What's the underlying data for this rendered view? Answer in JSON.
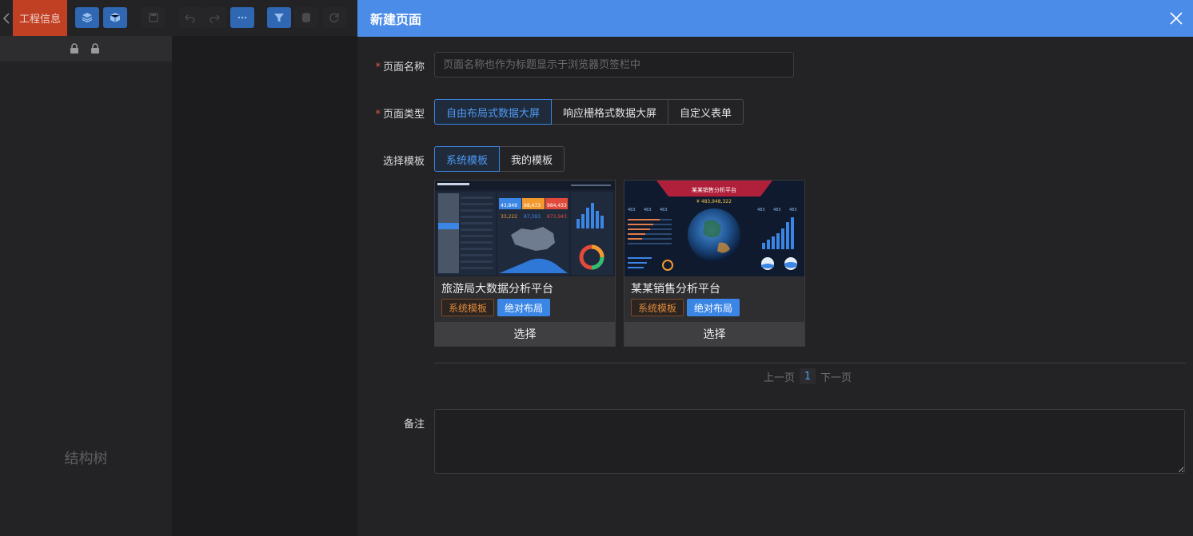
{
  "app": {
    "project_tab": "工程信息",
    "structure_label": "结构树"
  },
  "drawer": {
    "title": "新建页面",
    "name_field": {
      "label": "页面名称",
      "value": "",
      "placeholder": "页面名称也作为标题显示于浏览器页签栏中"
    },
    "type_field": {
      "label": "页面类型",
      "options": [
        "自由布局式数据大屏",
        "响应栅格式数据大屏",
        "自定义表单"
      ],
      "selected": "自由布局式数据大屏"
    },
    "template_field": {
      "label": "选择模板",
      "options": [
        "系统模板",
        "我的模板"
      ],
      "selected": "系统模板"
    },
    "templates": [
      {
        "title": "旅游局大数据分析平台",
        "tags": [
          "系统模板",
          "绝对布局"
        ],
        "select_label": "选择"
      },
      {
        "title": "某某销售分析平台",
        "tags": [
          "系统模板",
          "绝对布局"
        ],
        "select_label": "选择"
      }
    ],
    "thumbs": {
      "tour": {
        "k1": "43,849",
        "k2": "98,473",
        "k3": "984,433",
        "k4": "33,222",
        "k5": "87,383",
        "k6": "873,943"
      },
      "sales": {
        "title": "某某销售分析平台",
        "total": "¥ 483,948,322",
        "kpi": "483"
      }
    },
    "pager": {
      "prev": "上一页",
      "current": "1",
      "next": "下一页"
    },
    "remark_field": {
      "label": "备注",
      "value": ""
    }
  },
  "colors": {
    "header_blue": "#4b8ce8",
    "accent": "#3b86e5",
    "project_tab": "#c13f22",
    "tag_orange": "#e08a3a",
    "required": "#e05a44"
  }
}
